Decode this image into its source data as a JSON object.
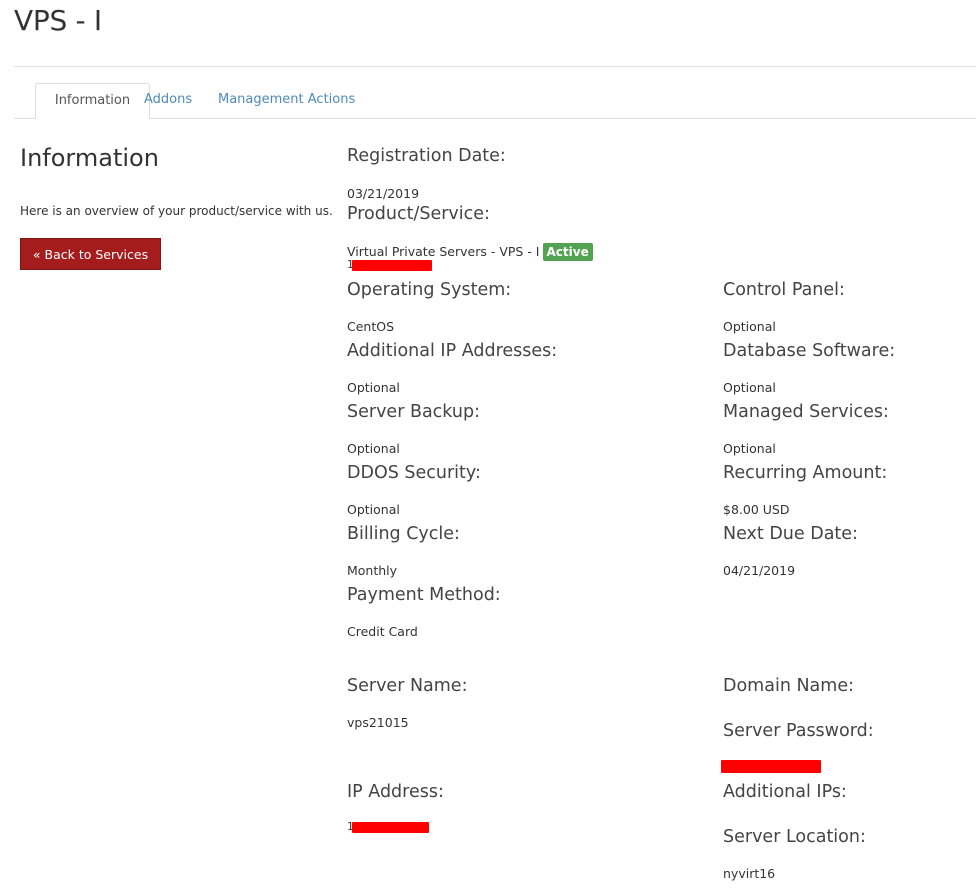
{
  "page": {
    "title": "VPS - I"
  },
  "tabs": [
    {
      "label": "Information",
      "active": true
    },
    {
      "label": "Addons",
      "active": false
    },
    {
      "label": "Management Actions",
      "active": false
    }
  ],
  "sidebar": {
    "heading": "Information",
    "description": "Here is an overview of your product/service with us.",
    "back_button": "« Back to Services List"
  },
  "fields": {
    "registration_date": {
      "label": "Registration Date:",
      "value": "03/21/2019"
    },
    "product_service": {
      "label": "Product/Service:",
      "value": "Virtual Private Servers - VPS - I",
      "status": "Active",
      "redacted_prefix": "1"
    },
    "operating_system": {
      "label": "Operating System:",
      "value": "CentOS"
    },
    "control_panel": {
      "label": "Control Panel:",
      "value": "Optional"
    },
    "additional_ip_addresses": {
      "label": "Additional IP Addresses:",
      "value": "Optional"
    },
    "database_software": {
      "label": "Database Software:",
      "value": "Optional"
    },
    "server_backup": {
      "label": "Server Backup:",
      "value": "Optional"
    },
    "managed_services": {
      "label": "Managed Services:",
      "value": "Optional"
    },
    "ddos_security": {
      "label": "DDOS Security:",
      "value": "Optional"
    },
    "recurring_amount": {
      "label": "Recurring Amount:",
      "value": "$8.00 USD"
    },
    "billing_cycle": {
      "label": "Billing Cycle:",
      "value": "Monthly"
    },
    "next_due_date": {
      "label": "Next Due Date:",
      "value": "04/21/2019"
    },
    "payment_method": {
      "label": "Payment Method:",
      "value": "Credit Card"
    },
    "server_name": {
      "label": "Server Name:",
      "value": "vps21015"
    },
    "domain_name": {
      "label": "Domain Name:",
      "value": ""
    },
    "server_password": {
      "label": "Server Password:",
      "value": ""
    },
    "ip_address": {
      "label": "IP Address:",
      "redacted_prefix": "1"
    },
    "additional_ips": {
      "label": "Additional IPs:",
      "value": ""
    },
    "server_location": {
      "label": "Server Location:",
      "value": "nyvirt16"
    }
  },
  "colors": {
    "accent_link": "#4f8ab8",
    "back_button": "#a51c1c",
    "status_active": "#51a351",
    "redaction": "#ff0000"
  }
}
